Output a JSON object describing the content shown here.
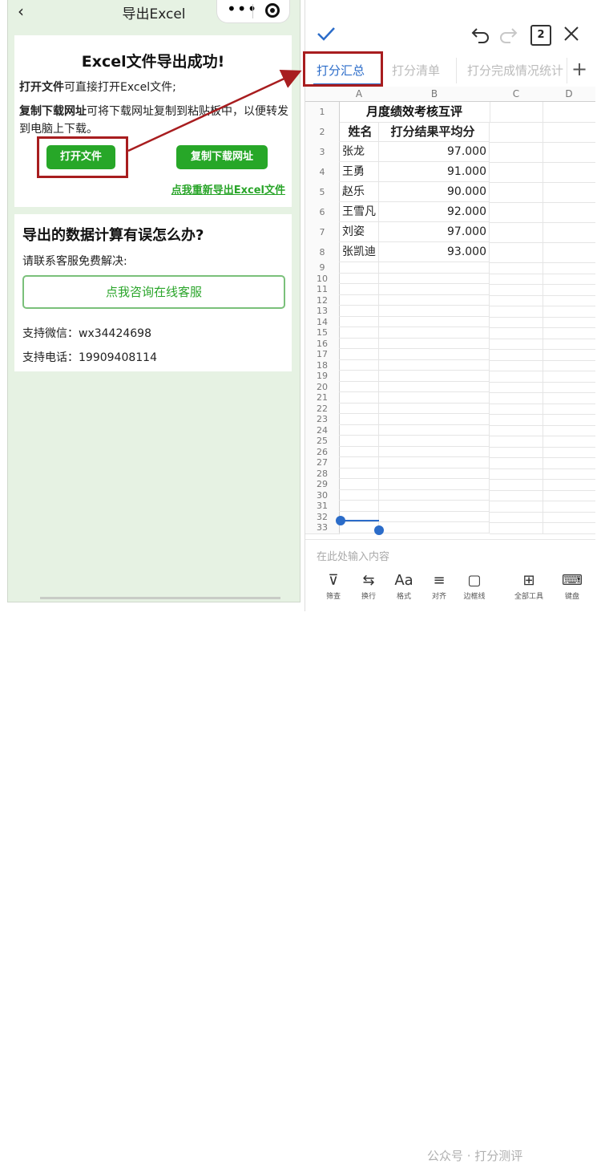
{
  "left": {
    "back_glyph": "‹",
    "title": "导出Excel",
    "capsule": {
      "menu_icon": "more-dots-icon",
      "close_icon": "target-close-icon",
      "dots": "•••"
    },
    "success_card": {
      "heading": "Excel文件导出成功!",
      "line1_bold": "打开文件",
      "line1_rest": "可直接打开Excel文件;",
      "line2_bold": "复制下载网址",
      "line2_rest": "可将下载网址复制到粘贴板中，以便转发到电脑上下载。",
      "open_button": "打开文件",
      "copy_button": "复制下载网址",
      "reexport_link": "点我重新导出Excel文件"
    },
    "help_card": {
      "heading": "导出的数据计算有误怎么办?",
      "sub": "请联系客服免费解决:",
      "consult_button": "点我咨询在线客服",
      "wechat": "支持微信：wx34424698",
      "phone": "支持电话：19909408114"
    }
  },
  "right": {
    "toolbar_icons": [
      "check-icon",
      "undo-icon",
      "redo-icon",
      "sheet-count-icon",
      "close-icon"
    ],
    "sheet_count": "2",
    "tabs": [
      {
        "label": "打分汇总",
        "active": true
      },
      {
        "label": "打分清单",
        "active": false
      },
      {
        "label": "打分完成情况统计",
        "active": false
      }
    ],
    "add_tab": "+",
    "columns": [
      "A",
      "B",
      "C",
      "D"
    ],
    "sheet": {
      "title": "月度绩效考核互评",
      "header": [
        "姓名",
        "打分结果平均分"
      ],
      "rows": [
        [
          "张龙",
          "97.000"
        ],
        [
          "王勇",
          "91.000"
        ],
        [
          "赵乐",
          "90.000"
        ],
        [
          "王雪凡",
          "92.000"
        ],
        [
          "刘姿",
          "97.000"
        ],
        [
          "张凯迪",
          "93.000"
        ]
      ]
    },
    "row_numbers": [
      "1",
      "2",
      "3",
      "4",
      "5",
      "6",
      "7",
      "8",
      "9",
      "10",
      "11",
      "12",
      "13",
      "14",
      "15",
      "16",
      "17",
      "18",
      "19",
      "20",
      "21",
      "22",
      "23",
      "24",
      "25",
      "26",
      "27",
      "28",
      "29",
      "30",
      "31",
      "32",
      "33"
    ],
    "input_placeholder": "在此处输入内容",
    "bottom_tools": [
      {
        "icon": "filter-icon",
        "label": "筛查",
        "glyph": "⊽"
      },
      {
        "icon": "wrap-icon",
        "label": "换行",
        "glyph": "⇆"
      },
      {
        "icon": "format-icon",
        "label": "格式",
        "glyph": "Aa"
      },
      {
        "icon": "align-icon",
        "label": "对齐",
        "glyph": "≡"
      },
      {
        "icon": "border-icon",
        "label": "边框线",
        "glyph": "▢"
      },
      {
        "icon": "all-tools-icon",
        "label": "全部工具",
        "glyph": "⊞"
      },
      {
        "icon": "keyboard-icon",
        "label": "键盘",
        "glyph": "⌨"
      }
    ],
    "watermark": "公众号 · 打分测评"
  },
  "colors": {
    "green": "#27a728",
    "highlight": "#a81d1f",
    "blue": "#2b6cc9"
  }
}
